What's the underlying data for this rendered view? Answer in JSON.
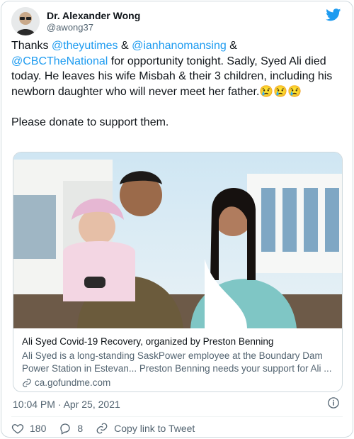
{
  "user": {
    "display_name": "Dr. Alexander Wong",
    "handle": "@awong37"
  },
  "tweet": {
    "segments": [
      {
        "text": "Thanks ",
        "type": "text"
      },
      {
        "text": "@theyutimes",
        "type": "mention"
      },
      {
        "text": " & ",
        "type": "text"
      },
      {
        "text": "@ianhanomansing",
        "type": "mention"
      },
      {
        "text": " & ",
        "type": "text"
      },
      {
        "text": "@CBCTheNational",
        "type": "mention"
      },
      {
        "text": " for opportunity tonight. Sadly, Syed Ali died today. He leaves his wife Misbah & their 3 children, including his newborn daughter who will never meet her father.",
        "type": "text"
      },
      {
        "text": "😢😢😢",
        "type": "emoji"
      }
    ],
    "second_paragraph": "Please donate to support them."
  },
  "card": {
    "title": "Ali Syed Covid-19 Recovery, organized by Preston Benning",
    "description": "Ali Syed is a long-standing SaskPower employee at the Boundary Dam Power Station in Estevan... Preston Benning needs your support for Ali ...",
    "domain": "ca.gofundme.com"
  },
  "meta": {
    "timestamp": "10:04 PM · Apr 25, 2021"
  },
  "actions": {
    "likes": "180",
    "replies": "8",
    "copy_link": "Copy link to Tweet"
  },
  "colors": {
    "brand": "#1d9bf0",
    "text": "#0f1419",
    "secondary": "#536471",
    "border": "#cfd9de"
  },
  "icons": [
    "twitter-logo-icon",
    "link-icon",
    "info-icon",
    "heart-icon",
    "reply-icon",
    "copy-link-icon"
  ]
}
